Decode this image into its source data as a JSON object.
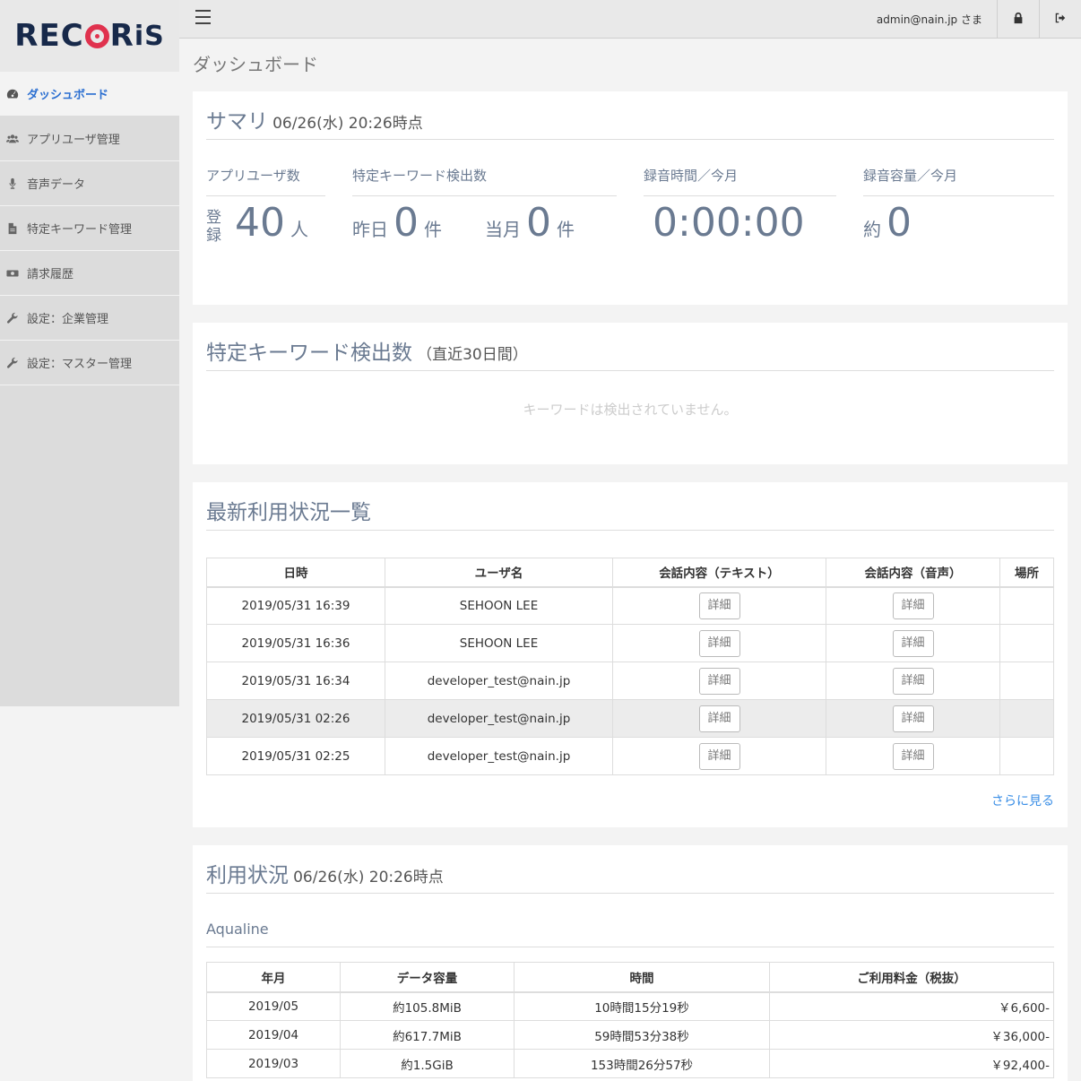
{
  "logo": {
    "text_a": "REC",
    "text_b": "R",
    "text_c": "iS"
  },
  "sidebar": {
    "items": [
      {
        "label": "ダッシュボード",
        "icon": "dashboard-icon"
      },
      {
        "label": "アプリユーザ管理",
        "icon": "users-icon"
      },
      {
        "label": "音声データ",
        "icon": "microphone-icon"
      },
      {
        "label": "特定キーワード管理",
        "icon": "document-icon"
      },
      {
        "label": "請求履歴",
        "icon": "money-icon"
      },
      {
        "label": "設定：企業管理",
        "icon": "wrench-icon"
      },
      {
        "label": "設定：マスター管理",
        "icon": "wrench-icon"
      }
    ]
  },
  "header": {
    "user": "admin@nain.jp さま"
  },
  "page_title": "ダッシュボード",
  "summary": {
    "title": "サマリ",
    "timestamp": "06/26(水) 20:26時点",
    "app_users": {
      "label": "アプリユーザ数",
      "prefix": "登録",
      "value": "40",
      "unit": "人"
    },
    "keyword": {
      "label": "特定キーワード検出数",
      "yesterday_prefix": "昨日",
      "yesterday_value": "0",
      "yesterday_unit": "件",
      "month_prefix": "当月",
      "month_value": "0",
      "month_unit": "件"
    },
    "rec_time": {
      "label": "録音時間／今月",
      "value": "0:00:00"
    },
    "rec_size": {
      "label": "録音容量／今月",
      "prefix": "約",
      "value": "0"
    }
  },
  "keyword_panel": {
    "title": "特定キーワード検出数",
    "period": "（直近30日間）",
    "empty": "キーワードは検出されていません。"
  },
  "recent": {
    "title": "最新利用状況一覧",
    "columns": [
      "日時",
      "ユーザ名",
      "会話内容（テキスト）",
      "会話内容（音声）",
      "場所"
    ],
    "detail_label": "詳細",
    "rows": [
      {
        "datetime": "2019/05/31 16:39",
        "user": "SEHOON LEE"
      },
      {
        "datetime": "2019/05/31 16:36",
        "user": "SEHOON LEE"
      },
      {
        "datetime": "2019/05/31 16:34",
        "user": "developer_test@nain.jp"
      },
      {
        "datetime": "2019/05/31 02:26",
        "user": "developer_test@nain.jp"
      },
      {
        "datetime": "2019/05/31 02:25",
        "user": "developer_test@nain.jp"
      }
    ],
    "more": "さらに見る"
  },
  "usage": {
    "title": "利用状況",
    "timestamp": "06/26(水) 20:26時点",
    "company": "Aqualine",
    "columns": [
      "年月",
      "データ容量",
      "時間",
      "ご利用料金（税抜）"
    ],
    "rows": [
      {
        "month": "2019/05",
        "size": "約105.8MiB",
        "time": "10時間15分19秒",
        "price": "￥6,600-"
      },
      {
        "month": "2019/04",
        "size": "約617.7MiB",
        "time": "59時間53分38秒",
        "price": "￥36,000-"
      },
      {
        "month": "2019/03",
        "size": "約1.5GiB",
        "time": "153時間26分57秒",
        "price": "￥92,400-"
      }
    ]
  }
}
